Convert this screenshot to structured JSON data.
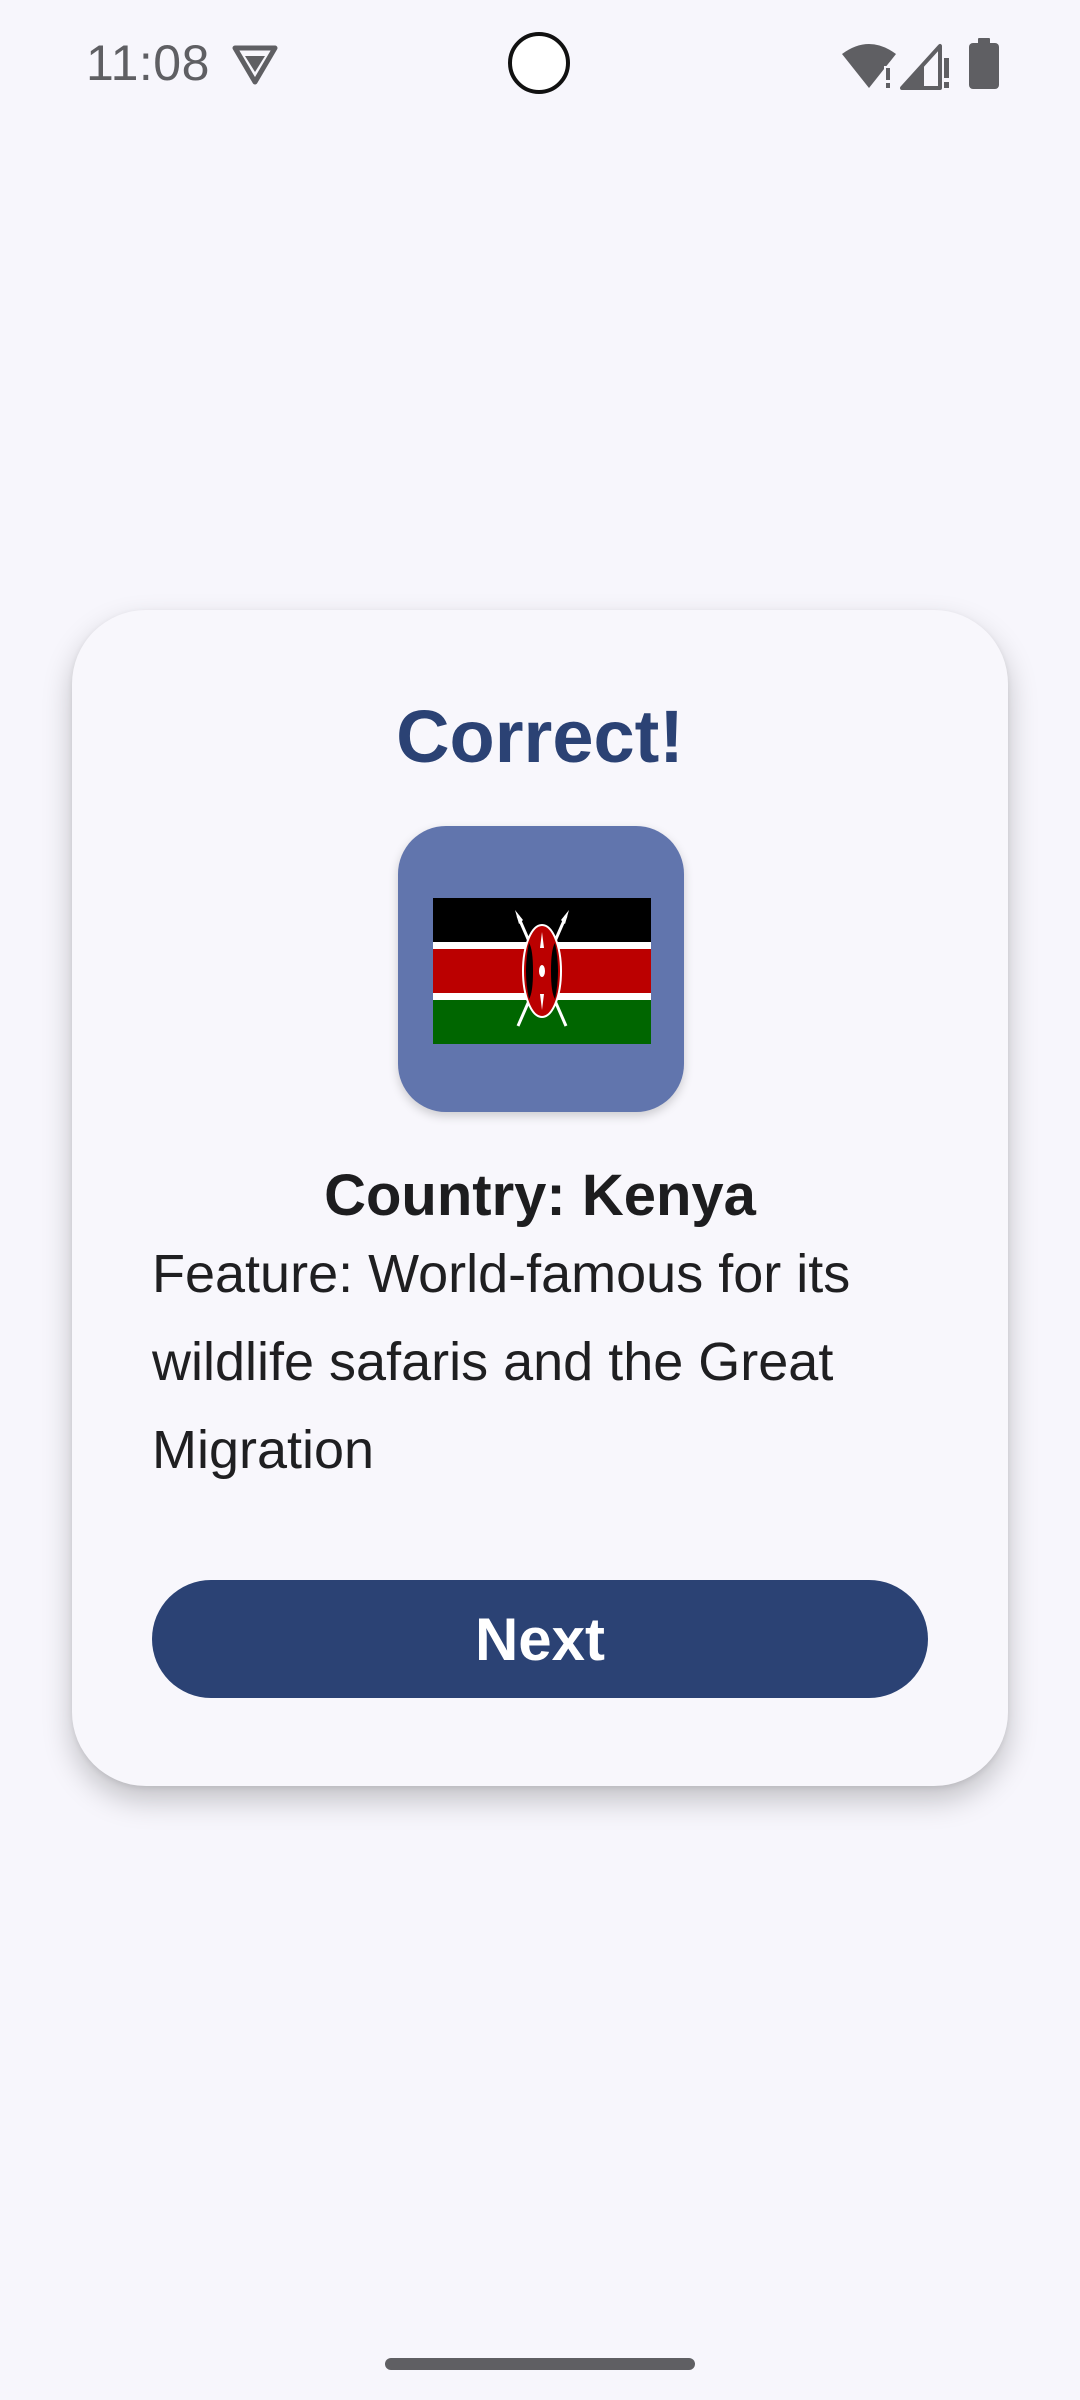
{
  "status_bar": {
    "time": "11:08",
    "icons": [
      "vpn-icon",
      "camera-cutout",
      "wifi-icon",
      "signal-icon",
      "battery-icon"
    ]
  },
  "card": {
    "title": "Correct!",
    "flag_icon": "kenya-flag-icon",
    "country": "Country: Kenya",
    "feature": "Feature: World-famous for its wildlife safaris and the Great Migration",
    "next_label": "Next"
  },
  "colors": {
    "accent": "#2b4274",
    "flag_tile": "#6175ad",
    "background": "#f7f6fc"
  }
}
